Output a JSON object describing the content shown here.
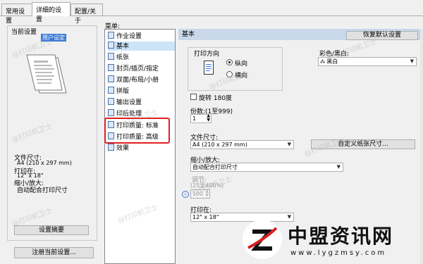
{
  "tabs": [
    "常用设置",
    "详细的设置",
    "配置/关于"
  ],
  "current": {
    "group_title": "当前设置",
    "user_setting": "用户设定",
    "summary_lines": [
      "文件尺寸:",
      "A4 (210 x 297 mm)",
      "打印在:",
      "12\" x 18\"",
      "缩小/放大:",
      "自动配合打印尺寸"
    ],
    "summary_button": "设置摘要",
    "register_button": "注册当前设置..."
  },
  "menu": {
    "label": "菜单:",
    "items": [
      "作业设置",
      "基本",
      "纸张",
      "封页/插页/指定",
      "双面/布局/小册",
      "拼版",
      "输出设置",
      "印后处理",
      "打印质量: 标准",
      "打印质量: 高级",
      "效果"
    ],
    "selected": "基本"
  },
  "panel": {
    "header": "基本",
    "restore_button": "恢复默认设置",
    "orientation_label": "打印方向",
    "portrait": "纵向",
    "landscape": "横向",
    "color_label": "彩色/黑白:",
    "color_value": "黑白",
    "rotate_label": "旋转 180度",
    "copies_label": "份数:(1至999)",
    "copies_value": "1",
    "paper_size_label": "文件尺寸:",
    "paper_size_value": "A4 (210 x 297 mm)",
    "custom_size_button": "自定义纸张尺寸...",
    "zoom_label": "缩小/放大:",
    "zoom_value": "自动配合打印尺寸",
    "scale_label": "调节:",
    "scale_range": "(25至400%)",
    "scale_value": "100",
    "print_on_label": "打印在:",
    "print_on_value": "12\" x 18\""
  },
  "watermarks": {
    "text": "@打印机卫士",
    "brand": "中盟资讯网",
    "url": "www.lygzmsy.com"
  },
  "colors": {
    "accent": "#0078d7",
    "highlight": "#e02020",
    "header": "#c8d7ea"
  }
}
